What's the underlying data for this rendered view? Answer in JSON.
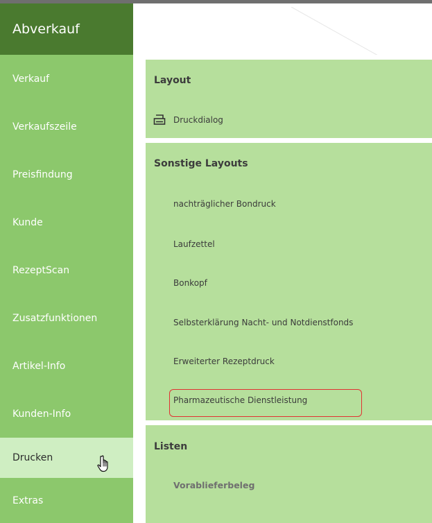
{
  "header": {
    "title": "Abverkauf"
  },
  "sidebar": {
    "items": [
      {
        "label": "Verkauf"
      },
      {
        "label": "Verkaufszeile"
      },
      {
        "label": "Preisfindung"
      },
      {
        "label": "Kunde"
      },
      {
        "label": "RezeptScan"
      },
      {
        "label": "Zusatzfunktionen"
      },
      {
        "label": "Artikel-Info"
      },
      {
        "label": "Kunden-Info"
      },
      {
        "label": "Drucken",
        "active": true
      },
      {
        "label": "Extras"
      }
    ]
  },
  "sections": {
    "layout": {
      "title": "Layout",
      "items": [
        {
          "label": "Druckdialog",
          "icon": "printer-icon"
        }
      ]
    },
    "sonstige": {
      "title": "Sonstige Layouts",
      "items": [
        {
          "label": "nachträglicher Bondruck"
        },
        {
          "label": "Laufzettel"
        },
        {
          "label": "Bonkopf"
        },
        {
          "label": "Selbsterklärung Nacht- und Notdienstfonds"
        },
        {
          "label": "Erweiterter Rezeptdruck"
        },
        {
          "label": "Pharmazeutische Dienstleistung",
          "highlighted": true
        }
      ]
    },
    "listen": {
      "title": "Listen",
      "items": [
        {
          "label": "Vorablieferbeleg"
        }
      ]
    }
  },
  "colors": {
    "brand_dark_green": "#4a7a2f",
    "sidebar_green": "#8cc86c",
    "sidebar_active": "#cfeec2",
    "content_green": "#b6df9c",
    "highlight_red": "#e23232"
  }
}
